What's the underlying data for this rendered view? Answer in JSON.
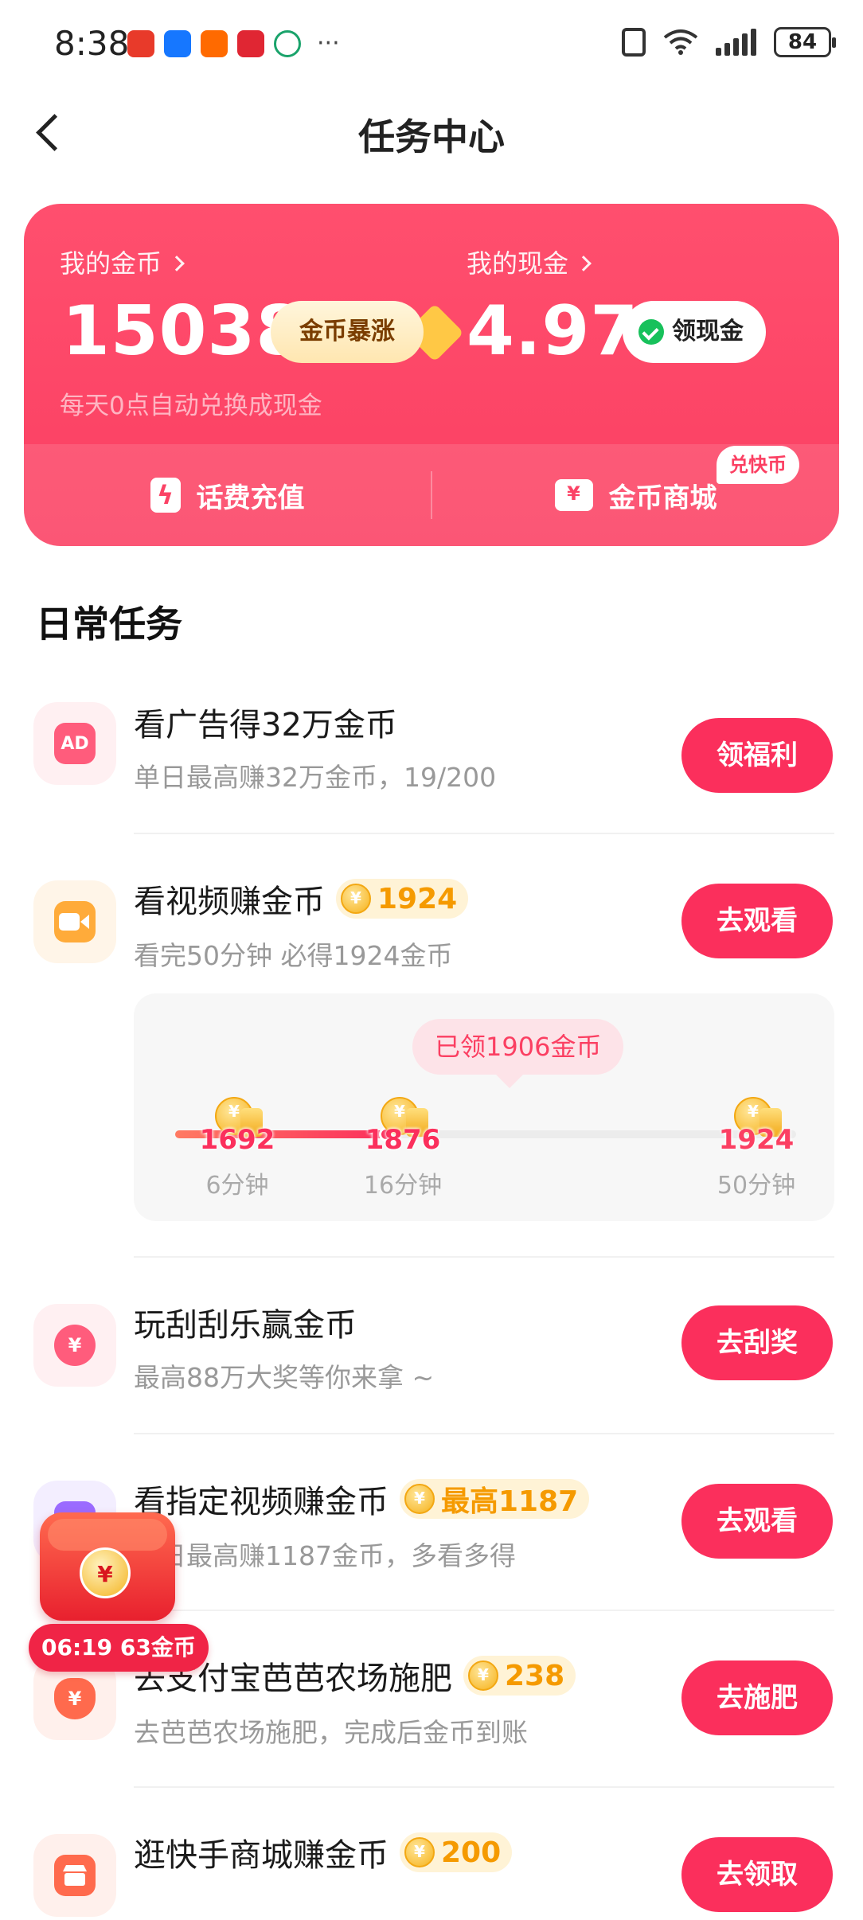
{
  "status_bar": {
    "time": "8:38",
    "more": "···",
    "battery": "84"
  },
  "header": {
    "title": "任务中心"
  },
  "wallet": {
    "coins_label": "我的金币",
    "coins_value": "15038",
    "boost_label": "金币暴涨",
    "cash_label": "我的现金",
    "cash_value": "4.97",
    "cash_button": "领现金",
    "note": "每天0点自动兑换成现金",
    "recharge_label": "话费充值",
    "mall_label": "金币商城",
    "mall_tag": "兑快币"
  },
  "daily": {
    "title": "日常任务",
    "tasks": [
      {
        "title": "看广告得32万金币",
        "sub": "单日最高赚32万金币，19/200",
        "button": "领福利",
        "icon": "ad-icon"
      },
      {
        "title": "看视频赚金币",
        "badge": "1924",
        "sub": "看完50分钟 必得1924金币",
        "button": "去观看",
        "icon": "video-camera-icon"
      },
      {
        "title": "玩刮刮乐赢金币",
        "sub": "最高88万大奖等你来拿 ~",
        "button": "去刮奖",
        "icon": "scratch-card-icon"
      },
      {
        "title": "看指定视频赚金币",
        "badge": "最高1187",
        "sub": "单日最高赚1187金币，多看多得",
        "button": "去观看",
        "icon": "play-icon"
      },
      {
        "title": "去支付宝芭芭农场施肥",
        "badge": "238",
        "sub": "去芭芭农场施肥，完成后金币到账",
        "button": "去施肥",
        "icon": "money-bag-icon"
      },
      {
        "title": "逛快手商城赚金币",
        "badge": "200",
        "sub": "",
        "button": "去领取",
        "icon": "store-icon"
      }
    ]
  },
  "video_progress": {
    "tip": "已领1906金币",
    "progress_fraction": 0.34,
    "milestones": [
      {
        "value": "1692",
        "time": "6分钟"
      },
      {
        "value": "1876",
        "time": "16分钟"
      },
      {
        "value": "1924",
        "time": "50分钟"
      }
    ]
  },
  "floating_reward": {
    "label": "06:19 63金币"
  },
  "colors": {
    "accent": "#fb2f5c",
    "card": "#ff4f6e",
    "coin": "#f59a00"
  }
}
